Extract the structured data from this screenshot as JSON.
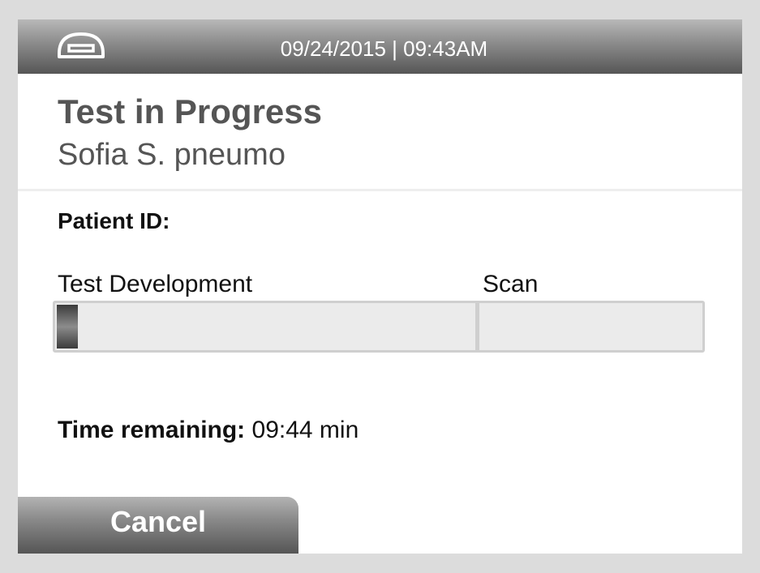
{
  "status_bar": {
    "datetime": "09/24/2015 | 09:43AM",
    "device_icon": "analyzer-device-icon"
  },
  "header": {
    "title": "Test in Progress",
    "subtitle": "Sofia S. pneumo"
  },
  "patient": {
    "id_label": "Patient ID:",
    "id_value": ""
  },
  "progress": {
    "development_label": "Test Development",
    "scan_label": "Scan",
    "development_fraction": 0.05,
    "scan_fraction": 0
  },
  "timer": {
    "label": "Time remaining:",
    "value": "09:44 min"
  },
  "actions": {
    "cancel_label": "Cancel"
  },
  "colors": {
    "bar_dark": "#565656",
    "text_gray": "#555555",
    "text_black": "#111111",
    "frame": "#dcdcdc"
  }
}
